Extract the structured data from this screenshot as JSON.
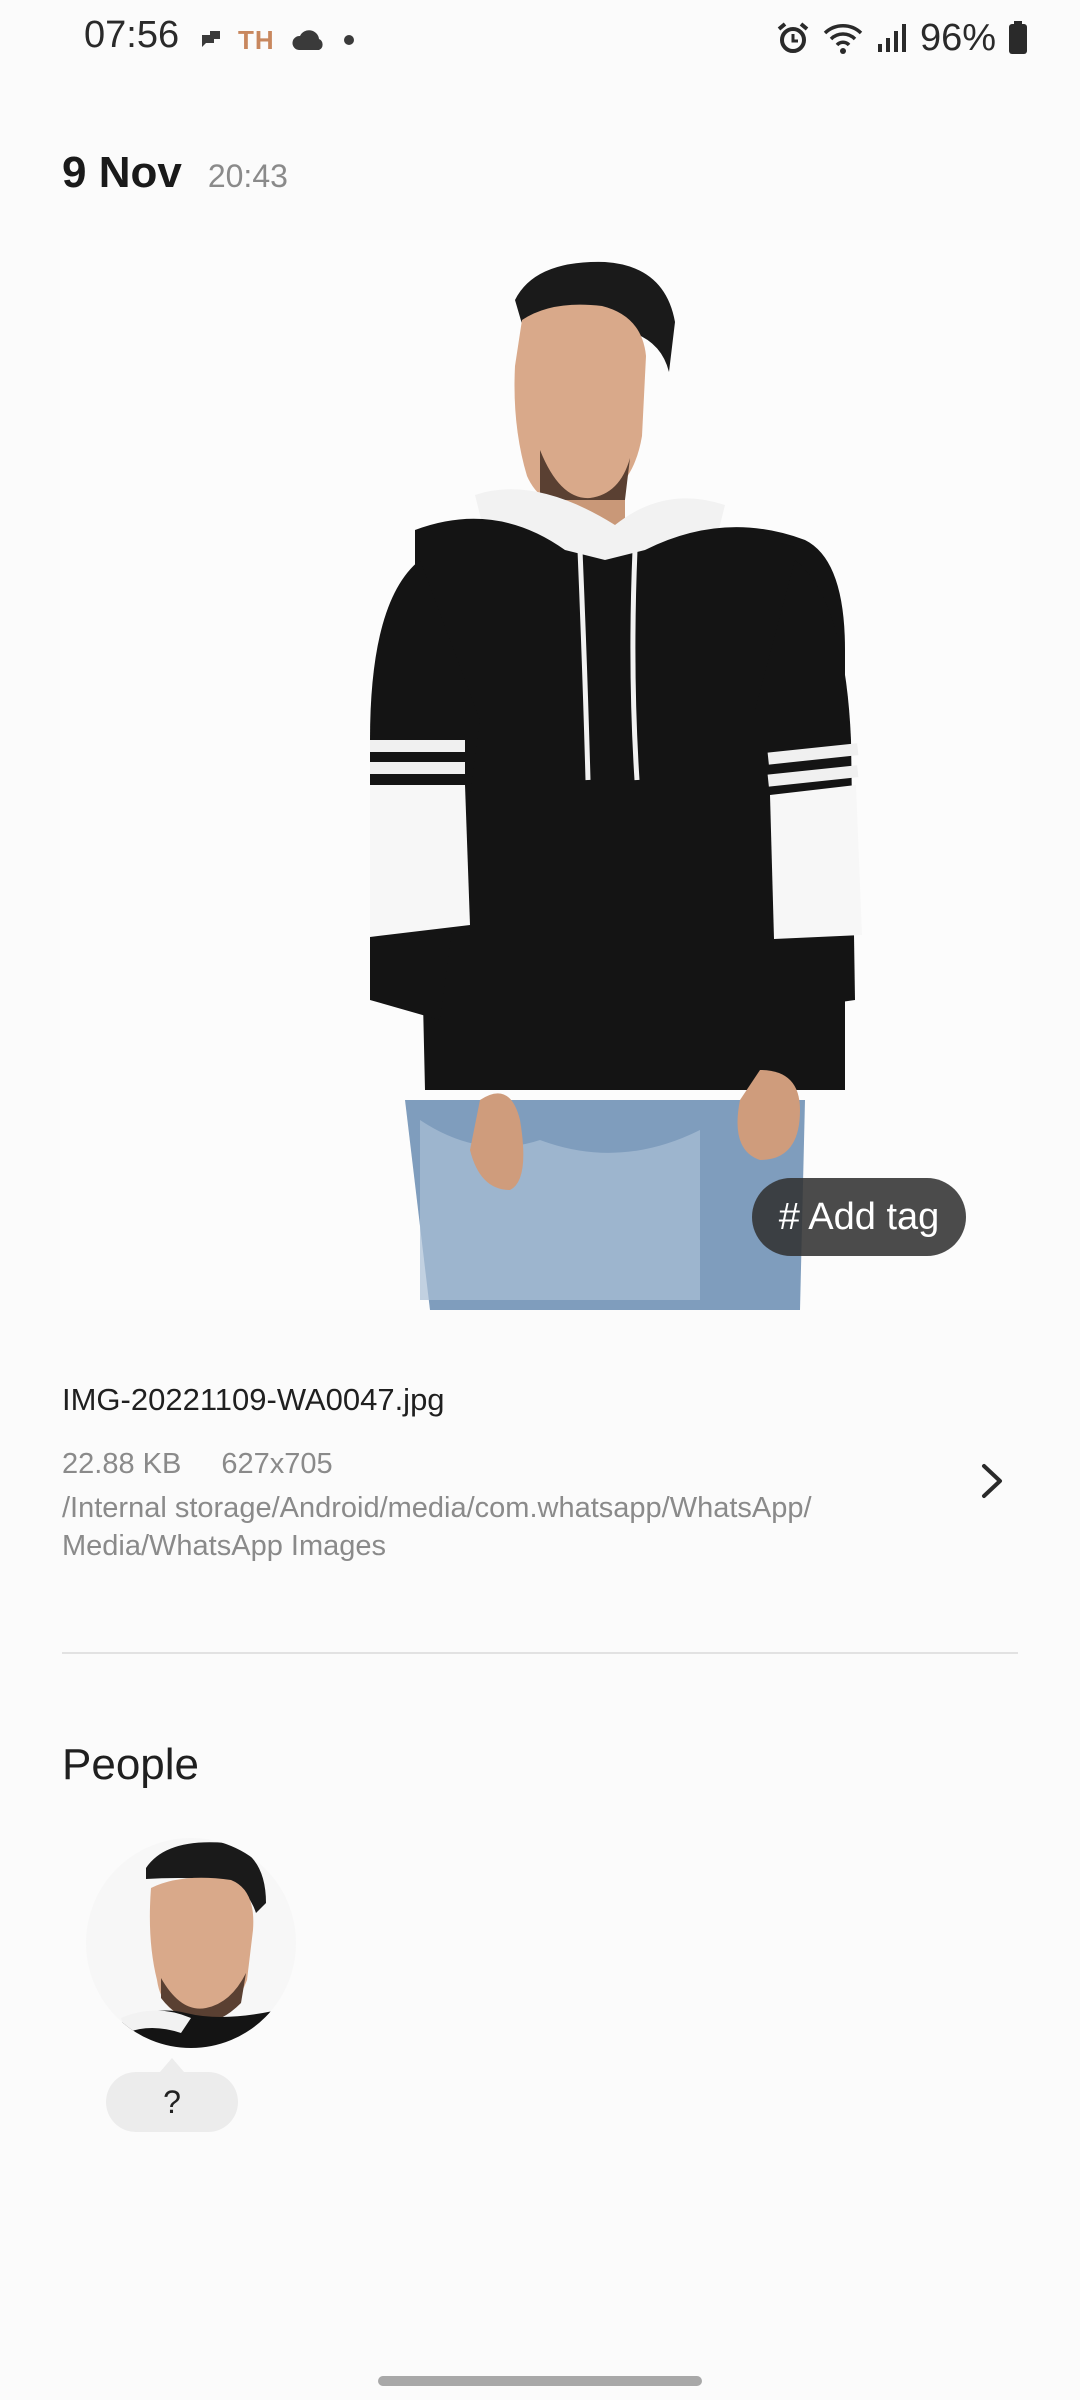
{
  "status_bar": {
    "time": "07:56",
    "battery": "96%",
    "icons_left": [
      "chat-icon",
      "th-icon",
      "cloud-icon",
      "dot-icon"
    ],
    "icons_right": [
      "alarm-icon",
      "wifi-icon",
      "signal-icon",
      "battery-icon"
    ],
    "th_label": "TH"
  },
  "header": {
    "date": "9 Nov",
    "time": "20:43"
  },
  "photo": {
    "add_tag_label": "# Add tag"
  },
  "file": {
    "name": "IMG-20221109-WA0047.jpg",
    "size": "22.88 KB",
    "resolution": "627x705",
    "path": "/Internal storage/Android/media/com.whatsapp/WhatsApp/ Media/WhatsApp Images"
  },
  "people": {
    "title": "People",
    "person_label": "?"
  },
  "colors": {
    "background": "#fbfbfb",
    "tag_background": "#323232",
    "secondary_text": "#8a8a8a",
    "th_icon": "#c8875e"
  }
}
